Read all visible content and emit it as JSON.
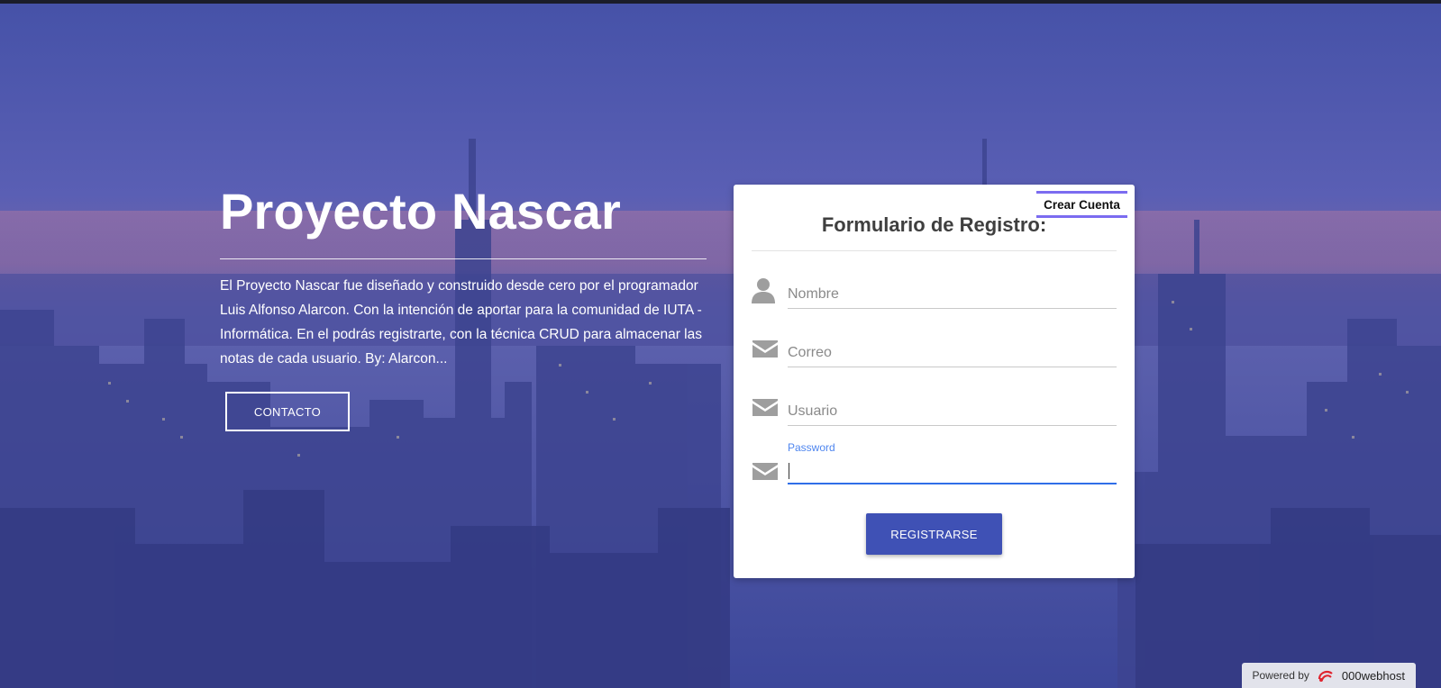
{
  "hero": {
    "title": "Proyecto Nascar",
    "description": "El Proyecto Nascar fue diseñado y construido desde cero por el programador Luis Alfonso Alarcon. Con la intención de aportar para la comunidad de IUTA - Informática. En el podrás registrarte, con la técnica CRUD para almacenar las notas de cada usuario. By: Alarcon...",
    "contact_label": "CONTACTO"
  },
  "form": {
    "tab_label": "Crear Cuenta",
    "title": "Formulario de Registro:",
    "fields": [
      {
        "placeholder": "Nombre",
        "value": "",
        "icon": "person-icon"
      },
      {
        "placeholder": "Correo",
        "value": "",
        "icon": "envelope-icon"
      },
      {
        "placeholder": "Usuario",
        "value": "",
        "icon": "envelope-icon"
      },
      {
        "label": "Password",
        "value": "",
        "icon": "envelope-icon",
        "focused": true
      }
    ],
    "submit_label": "REGISTRARSE"
  },
  "footer": {
    "powered_by": "Powered by",
    "host_name": "000webhost"
  },
  "colors": {
    "overlay": "#4a55b0",
    "primary_button": "#3f51b5",
    "tab_accent": "#7b6cf0",
    "focus_underline": "#2f6ee8"
  }
}
